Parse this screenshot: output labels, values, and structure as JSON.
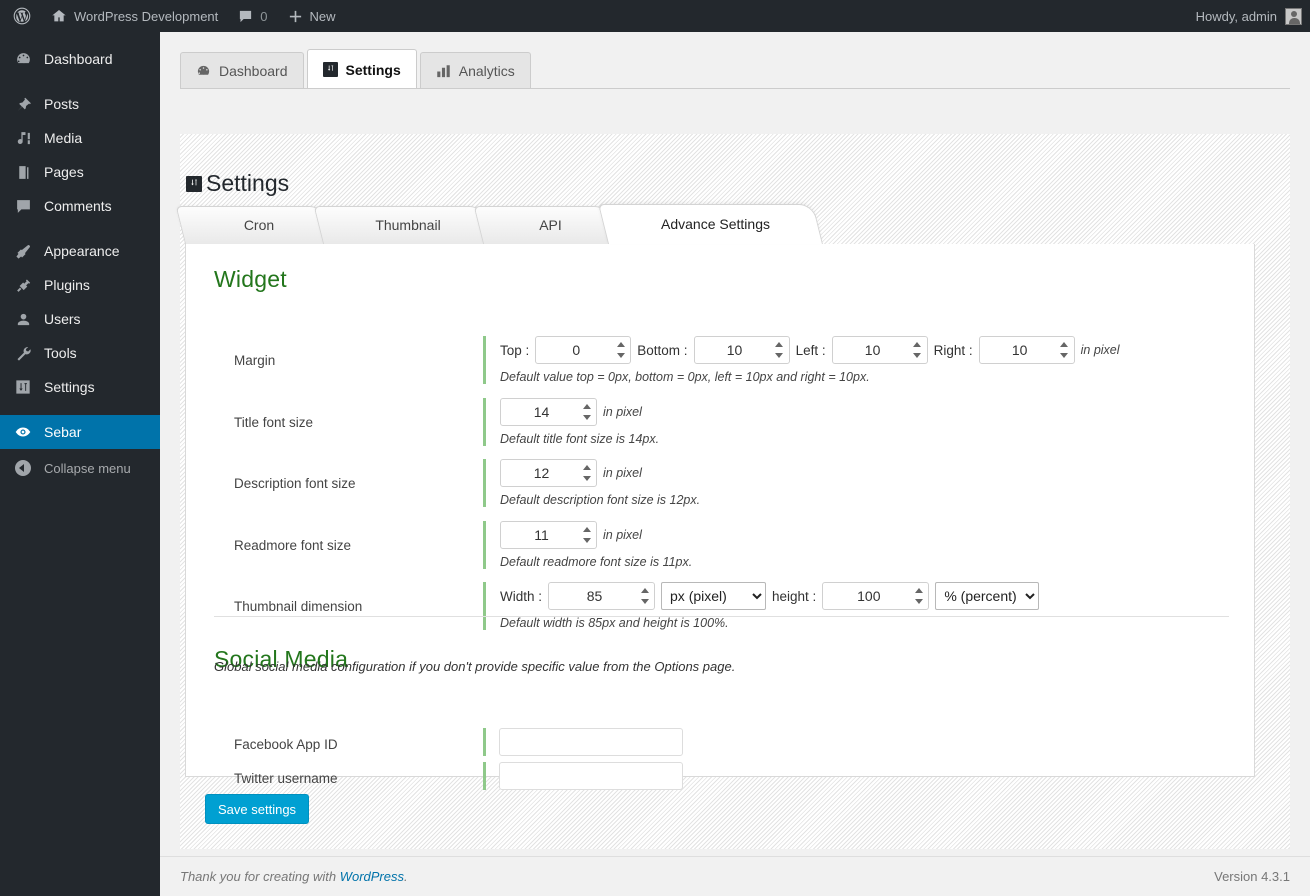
{
  "adminbar": {
    "site_title": "WordPress Development",
    "comment_count": "0",
    "new_label": "New",
    "howdy": "Howdy, admin",
    "logo_icon": "wordpress-logo-icon",
    "home_icon": "home-icon",
    "comment_icon": "comment-bubble-icon",
    "plus_icon": "plus-icon",
    "avatar_icon": "avatar-icon"
  },
  "sidebar": {
    "items": [
      {
        "label": "Dashboard",
        "icon": "dashboard-icon",
        "current": false
      },
      {
        "label": "Posts",
        "icon": "pin-icon",
        "current": false
      },
      {
        "label": "Media",
        "icon": "media-icon",
        "current": false
      },
      {
        "label": "Pages",
        "icon": "pages-icon",
        "current": false
      },
      {
        "label": "Comments",
        "icon": "comment-bubble-icon",
        "current": false
      },
      {
        "label": "Appearance",
        "icon": "paintbrush-icon",
        "current": false
      },
      {
        "label": "Plugins",
        "icon": "plug-icon",
        "current": false
      },
      {
        "label": "Users",
        "icon": "user-icon",
        "current": false
      },
      {
        "label": "Tools",
        "icon": "wrench-icon",
        "current": false
      },
      {
        "label": "Settings",
        "icon": "settings-sliders-icon",
        "current": false
      },
      {
        "label": "Sebar",
        "icon": "sebar-icon",
        "current": true
      }
    ],
    "collapse_label": "Collapse menu",
    "collapse_icon": "collapse-arrow-icon",
    "active_color": "#0073aa",
    "background_color": "#23282d"
  },
  "top_tabs": [
    {
      "label": "Dashboard",
      "icon": "dashboard-icon",
      "active": false
    },
    {
      "label": "Settings",
      "icon": "settings-sliders-icon",
      "active": true
    },
    {
      "label": "Analytics",
      "icon": "bar-chart-icon",
      "active": false
    }
  ],
  "page": {
    "title": "Settings",
    "title_icon": "settings-sliders-icon"
  },
  "sub_tabs": [
    {
      "label": "Cron",
      "active": false
    },
    {
      "label": "Thumbnail",
      "active": false
    },
    {
      "label": "API",
      "active": false
    },
    {
      "label": "Advance Settings",
      "active": true
    }
  ],
  "widget": {
    "heading": "Widget",
    "heading_color": "#23761c",
    "margin": {
      "label": "Margin",
      "top_label": "Top :",
      "top_value": "0",
      "bottom_label": "Bottom :",
      "bottom_value": "10",
      "left_label": "Left :",
      "left_value": "10",
      "right_label": "Right :",
      "right_value": "10",
      "unit": "in pixel",
      "note": "Default value top = 0px, bottom = 0px, left = 10px and right = 10px."
    },
    "title_font": {
      "label": "Title font size",
      "value": "14",
      "unit": "in pixel",
      "note": "Default title font size is 14px."
    },
    "description_font": {
      "label": "Description font size",
      "value": "12",
      "unit": "in pixel",
      "note": "Default description font size is 12px."
    },
    "readmore_font": {
      "label": "Readmore font size",
      "value": "11",
      "unit": "in pixel",
      "note": "Default readmore font size is 11px."
    },
    "thumbnail": {
      "label": "Thumbnail dimension",
      "width_label": "Width :",
      "width_value": "85",
      "width_unit": "px (pixel)",
      "width_unit_options": [
        "px (pixel)",
        "% (percent)"
      ],
      "height_label": "height :",
      "height_value": "100",
      "height_unit": "% (percent)",
      "height_unit_options": [
        "px (pixel)",
        "% (percent)"
      ],
      "note": "Default width is 85px and height is 100%."
    }
  },
  "social": {
    "heading": "Social Media",
    "heading_color": "#23761c",
    "subtitle": "Global social media configuration if you don't provide specific value from the Options page.",
    "facebook": {
      "label": "Facebook App ID",
      "value": ""
    },
    "twitter": {
      "label": "Twitter username",
      "value": ""
    }
  },
  "save_button": {
    "label": "Save settings",
    "color": "#00a0d2"
  },
  "footer": {
    "thanks_prefix": "Thank you for creating with ",
    "link_text": "WordPress",
    "thanks_suffix": ".",
    "version": "Version 4.3.1"
  }
}
